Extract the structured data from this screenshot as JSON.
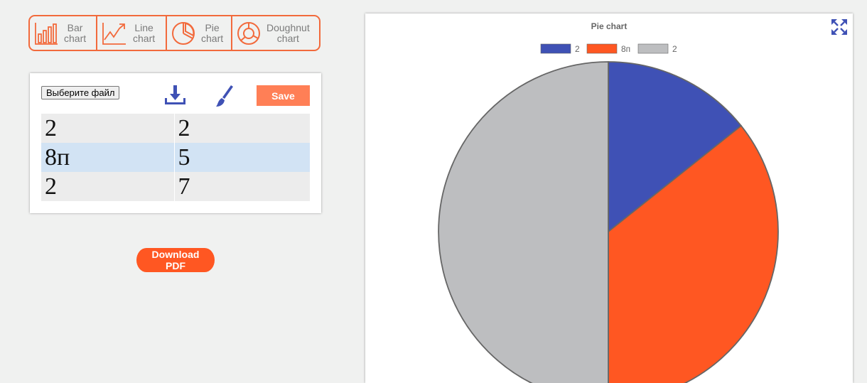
{
  "chart_types": [
    {
      "line1": "Bar",
      "line2": "chart",
      "icon": "bar-chart-icon"
    },
    {
      "line1": "Line",
      "line2": "chart",
      "icon": "line-chart-icon"
    },
    {
      "line1": "Pie",
      "line2": "chart",
      "icon": "pie-chart-icon"
    },
    {
      "line1": "Doughnut",
      "line2": "chart",
      "icon": "doughnut-chart-icon"
    }
  ],
  "panel": {
    "file_button": "Выберите файл",
    "save_label": "Save",
    "download_icon": "download-icon",
    "brush_icon": "paint-brush-icon",
    "rows": [
      {
        "label": "2",
        "value": "2"
      },
      {
        "label": "8п",
        "value": "5"
      },
      {
        "label": "2",
        "value": "7"
      }
    ]
  },
  "download_pdf_label": "Download PDF",
  "expand_icon": "expand-icon",
  "colors": {
    "accent": "#f26a3c",
    "save": "#ff7f56",
    "pdf": "#ff5722",
    "icon_blue": "#3f51b5"
  },
  "chart_data": {
    "type": "pie",
    "title": "Pie chart",
    "labels": [
      "2",
      "8п",
      "2"
    ],
    "values": [
      2,
      5,
      7
    ],
    "colors": [
      "#3f51b5",
      "#ff5722",
      "#bdbec0"
    ],
    "legend_position": "top"
  }
}
